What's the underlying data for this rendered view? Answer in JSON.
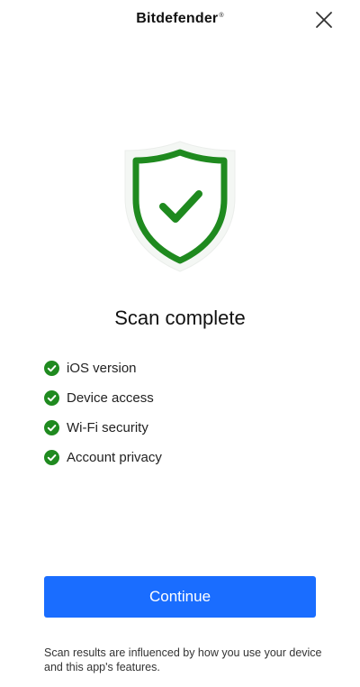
{
  "header": {
    "brand": "Bitdefender",
    "brand_mark": "®"
  },
  "result": {
    "title": "Scan complete",
    "items": [
      {
        "label": "iOS version"
      },
      {
        "label": "Device access"
      },
      {
        "label": "Wi-Fi security"
      },
      {
        "label": "Account privacy"
      }
    ]
  },
  "actions": {
    "continue_label": "Continue"
  },
  "footer": {
    "note": "Scan results are influenced by how you use your device and this app's features."
  },
  "icons": {
    "close": "close-icon",
    "shield": "shield-check-icon",
    "item_check": "check-circle-icon"
  },
  "colors": {
    "accent": "#1a6dff",
    "success": "#1f8a1f"
  }
}
